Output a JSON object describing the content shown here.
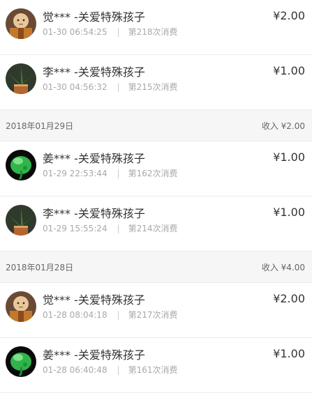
{
  "entries": [
    {
      "type": "record",
      "avatar": "monk-avatar-icon",
      "title": "觉*** -关爱特殊孩子",
      "time": "01-30 06:54:25",
      "count": "第218次消费",
      "amount": "¥2.00"
    },
    {
      "type": "record",
      "avatar": "plant-avatar-icon",
      "title": "李*** -关爱特殊孩子",
      "time": "01-30 04:56:32",
      "count": "第215次消费",
      "amount": "¥1.00"
    },
    {
      "type": "header",
      "date": "2018年01月29日",
      "income": "收入 ¥2.00"
    },
    {
      "type": "record",
      "avatar": "green-leaf-avatar-icon",
      "title": "姜*** -关爱特殊孩子",
      "time": "01-29 22:53:44",
      "count": "第162次消费",
      "amount": "¥1.00"
    },
    {
      "type": "record",
      "avatar": "plant-avatar-icon",
      "title": "李*** -关爱特殊孩子",
      "time": "01-29 15:55:24",
      "count": "第214次消费",
      "amount": "¥1.00"
    },
    {
      "type": "header",
      "date": "2018年01月28日",
      "income": "收入 ¥4.00"
    },
    {
      "type": "record",
      "avatar": "monk-avatar-icon",
      "title": "觉*** -关爱特殊孩子",
      "time": "01-28 08:04:18",
      "count": "第217次消费",
      "amount": "¥2.00"
    },
    {
      "type": "record",
      "avatar": "green-leaf-avatar-icon",
      "title": "姜*** -关爱特殊孩子",
      "time": "01-28 06:40:48",
      "count": "第161次消费",
      "amount": "¥1.00"
    }
  ],
  "separator": "|"
}
